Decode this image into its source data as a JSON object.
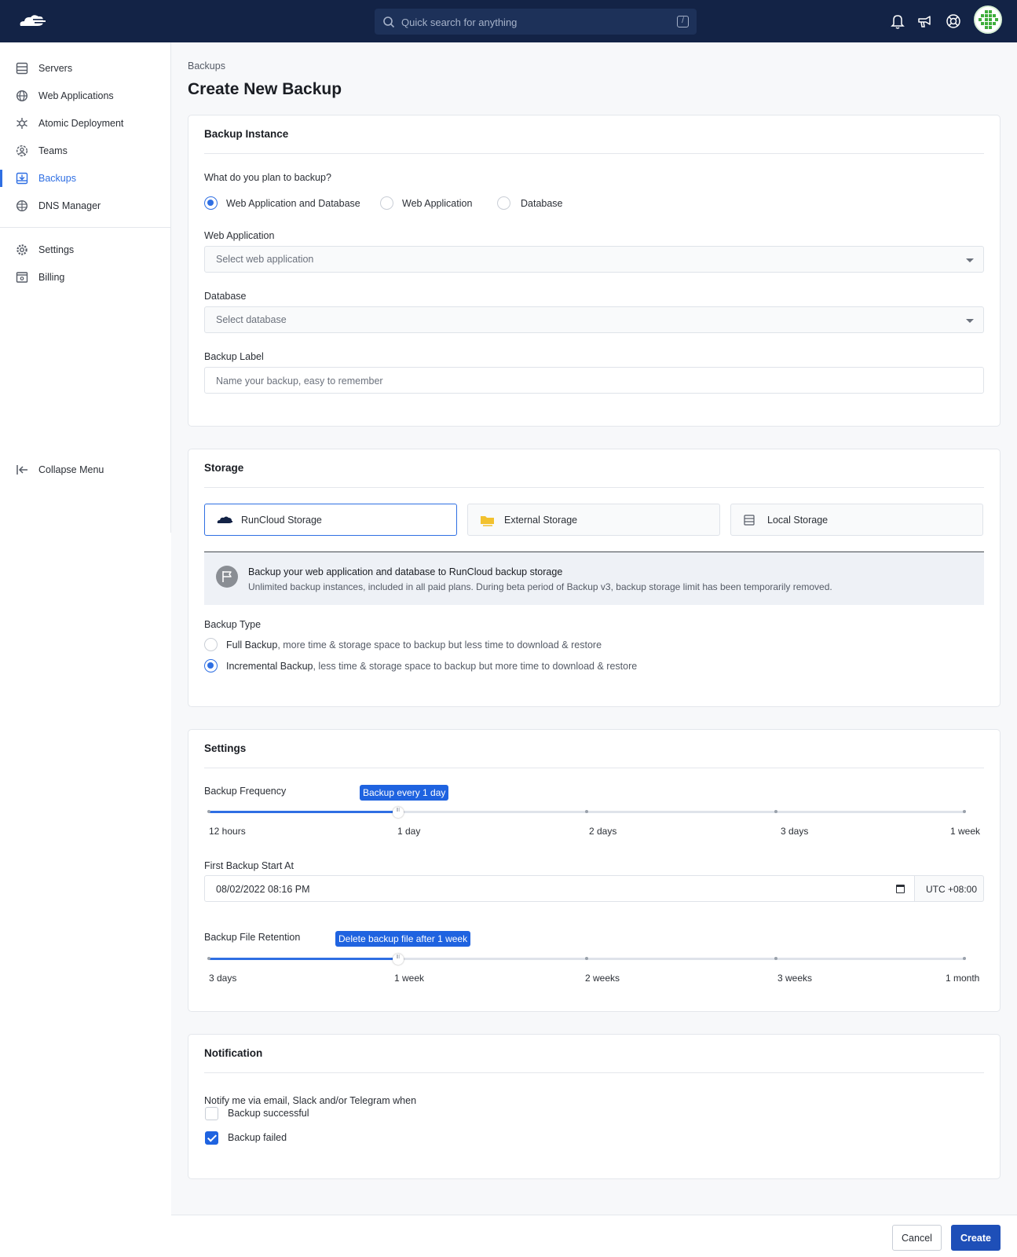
{
  "search": {
    "placeholder": "Quick search for anything",
    "shortcut": "/"
  },
  "sidebar": {
    "items": [
      {
        "label": "Servers",
        "icon": "server-icon"
      },
      {
        "label": "Web Applications",
        "icon": "globe-icon"
      },
      {
        "label": "Atomic Deployment",
        "icon": "atom-icon"
      },
      {
        "label": "Teams",
        "icon": "team-icon"
      },
      {
        "label": "Backups",
        "icon": "backup-icon",
        "active": true
      },
      {
        "label": "DNS Manager",
        "icon": "dns-icon"
      }
    ],
    "secondary": [
      {
        "label": "Settings",
        "icon": "gear-icon"
      },
      {
        "label": "Billing",
        "icon": "billing-icon"
      }
    ],
    "collapse_label": "Collapse Menu"
  },
  "breadcrumb": "Backups",
  "page_title": "Create New Backup",
  "backup_instance": {
    "title": "Backup Instance",
    "question": "What do you plan to backup?",
    "options": [
      "Web Application and Database",
      "Web Application",
      "Database"
    ],
    "selected_option": "Web Application and Database",
    "web_app_label": "Web Application",
    "web_app_placeholder": "Select web application",
    "database_label": "Database",
    "database_placeholder": "Select database",
    "backup_label_label": "Backup Label",
    "backup_label_placeholder": "Name your backup, easy to remember"
  },
  "storage": {
    "title": "Storage",
    "options": [
      "RunCloud Storage",
      "External Storage",
      "Local Storage"
    ],
    "selected": "RunCloud Storage",
    "info_title": "Backup your web application and database to RunCloud backup storage",
    "info_text": "Unlimited backup instances, included in all paid plans. During beta period of Backup v3, backup storage limit has been temporarily removed.",
    "type_label": "Backup Type",
    "types": [
      {
        "name": "Full Backup",
        "desc": ", more time & storage space to backup but less time to download & restore",
        "checked": false
      },
      {
        "name": "Incremental Backup",
        "desc": ", less time & storage space to backup but more time to download & restore",
        "checked": true
      }
    ]
  },
  "settings": {
    "title": "Settings",
    "frequency_label": "Backup Frequency",
    "frequency_tooltip": "Backup every 1 day",
    "frequency_ticks": [
      "12 hours",
      "1 day",
      "2 days",
      "3 days",
      "1 week"
    ],
    "frequency_value_index": 1,
    "start_label": "First Backup Start At",
    "start_value": "08/02/2022 08:16 PM",
    "timezone": "UTC +08:00",
    "retention_label": "Backup File Retention",
    "retention_tooltip": "Delete backup file after 1 week",
    "retention_ticks": [
      "3 days",
      "1 week",
      "2 weeks",
      "3 weeks",
      "1 month"
    ],
    "retention_value_index": 1
  },
  "notification": {
    "title": "Notification",
    "question": "Notify me via email, Slack and/or Telegram when",
    "options": [
      {
        "label": "Backup successful",
        "checked": false
      },
      {
        "label": "Backup failed",
        "checked": true
      }
    ]
  },
  "footer": {
    "cancel_label": "Cancel",
    "create_label": "Create"
  },
  "colors": {
    "topbar": "#132346",
    "accent": "#2f6fe3",
    "primary_button": "#1e4fb8"
  }
}
